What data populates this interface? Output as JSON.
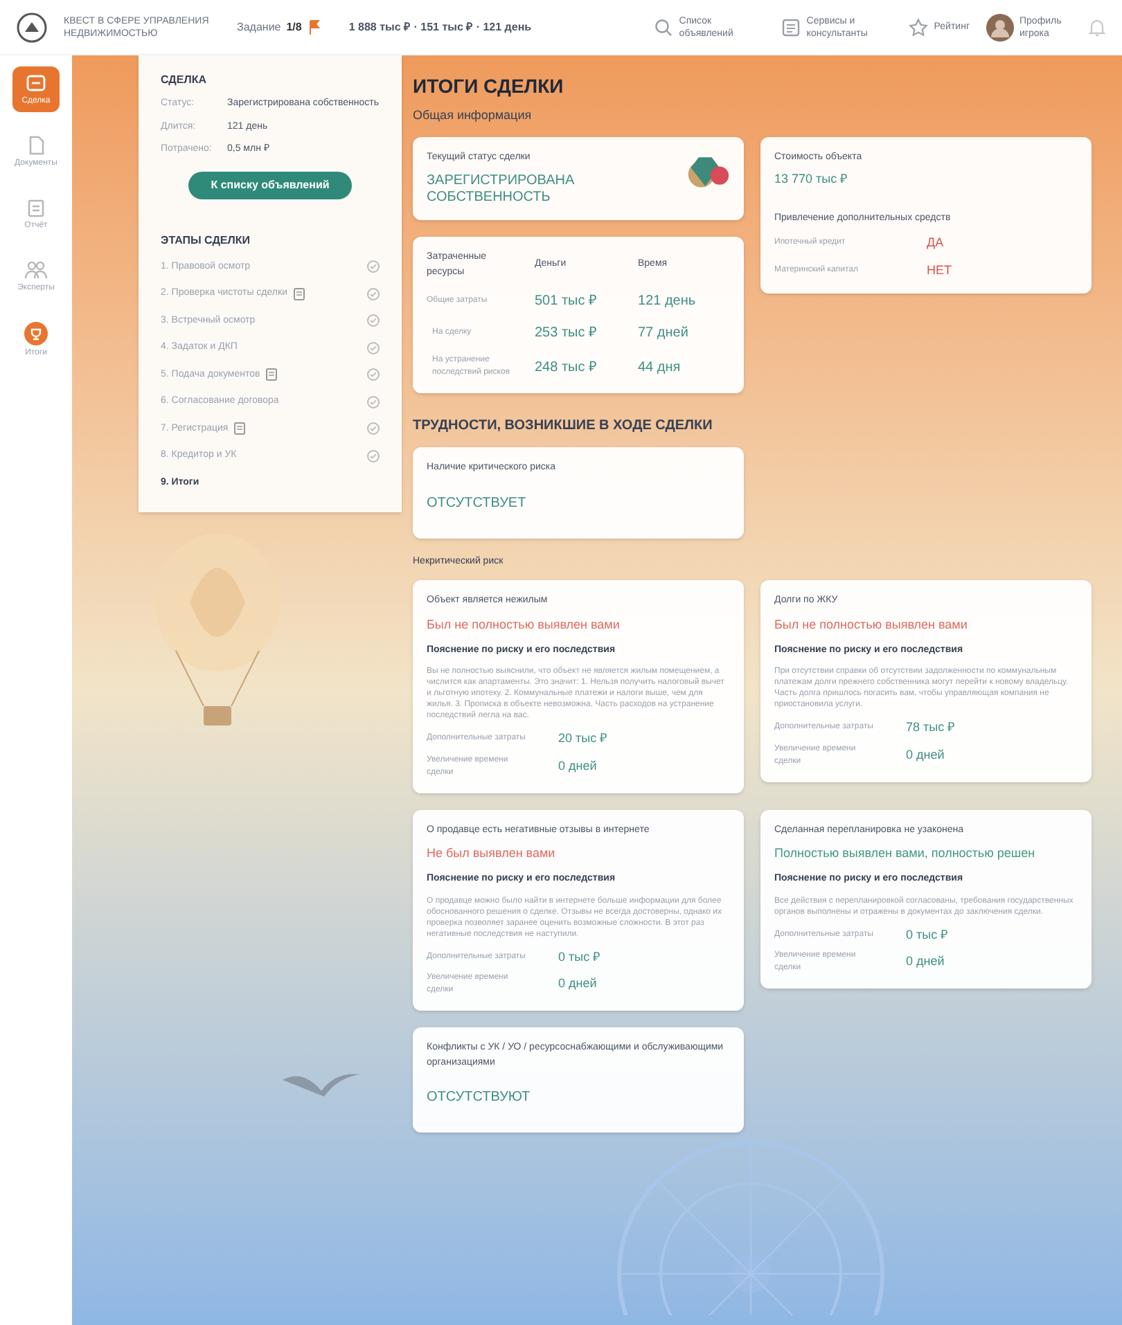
{
  "header": {
    "title": "КВЕСТ В СФЕРЕ УПРАВЛЕНИЯ НЕДВИЖИМОСТЬЮ",
    "task_label": "Задание",
    "task_value": "1/8",
    "stats": "1 888 тыс ₽ · 151 тыс ₽ · 121 день",
    "nav": [
      {
        "label": "Список объявлений",
        "kind": "search"
      },
      {
        "label": "Сервисы и консультанты",
        "kind": "list"
      },
      {
        "label": "Рейтинг",
        "kind": "star"
      }
    ],
    "profile": "Профиль игрока"
  },
  "rail": [
    {
      "label": "Сделка",
      "kind": "deal",
      "selected": true
    },
    {
      "label": "Документы",
      "kind": "doc",
      "selected": false
    },
    {
      "label": "Отчёт",
      "kind": "report",
      "selected": false
    },
    {
      "label": "Эксперты",
      "kind": "people",
      "selected": false
    },
    {
      "label": "Итоги",
      "kind": "result",
      "selected": false
    }
  ],
  "deal": {
    "title": "СДЕЛКА",
    "fields": [
      {
        "label": "Статус:",
        "value": "Зарегистрирована собственность"
      },
      {
        "label": "Длится:",
        "value": "121 день"
      },
      {
        "label": "Потрачено:",
        "value": "0,5 млн ₽"
      }
    ],
    "button": "К списку объявлений",
    "stages_title": "ЭТАПЫ СДЕЛКИ",
    "stages": [
      {
        "label": "1. Правовой осмотр",
        "document": false,
        "done": true,
        "selected": false
      },
      {
        "label": "2. Проверка чистоты сделки",
        "document": true,
        "done": true,
        "selected": false
      },
      {
        "label": "3. Встречный осмотр",
        "document": false,
        "done": true,
        "selected": false
      },
      {
        "label": "4. Задаток и ДКП",
        "document": false,
        "done": true,
        "selected": false
      },
      {
        "label": "5. Подача документов",
        "document": true,
        "done": true,
        "selected": false
      },
      {
        "label": "6. Согласование договора",
        "document": false,
        "done": true,
        "selected": false
      },
      {
        "label": "7. Регистрация",
        "document": true,
        "done": true,
        "selected": false
      },
      {
        "label": "8. Кредитор и УК",
        "document": false,
        "done": true,
        "selected": false
      },
      {
        "label": "9. Итоги",
        "document": false,
        "done": false,
        "selected": true
      }
    ]
  },
  "summary": {
    "title": "ИТОГИ СДЕЛКИ",
    "subtitle": "Общая информация",
    "status": {
      "label": "Текущий статус сделки",
      "value": "ЗАРЕГИСТРИРОВАНА СОБСТВЕННОСТЬ"
    },
    "price": {
      "label": "Стоимость объекта",
      "value": "13 770 тыс ₽",
      "funds_title": "Привлечение дополнительных средств",
      "funds": [
        {
          "label": "Ипотечный кредит",
          "value": "ДА"
        },
        {
          "label": "Материнский капитал",
          "value": "НЕТ"
        }
      ]
    },
    "resources": {
      "columns": [
        "Затраченные ресурсы",
        "Деньги",
        "Время"
      ],
      "rows": [
        {
          "label": "Общие затраты",
          "money": "501 тыс ₽",
          "time": "121 день"
        },
        {
          "label": "На сделку",
          "money": "253 тыс ₽",
          "time": "77 дней"
        },
        {
          "label": "На устранение последствий рисков",
          "money": "248 тыс ₽",
          "time": "44 дня"
        }
      ]
    }
  },
  "difficulties": {
    "title": "ТРУДНОСТИ, ВОЗНИКШИЕ В ХОДЕ СДЕЛКИ",
    "critical": {
      "label": "Наличие критического риска",
      "value": "ОТСУТСТВУЕТ"
    },
    "noncritical_label": "Некритический риск",
    "risks": [
      {
        "title": "Объект является нежилым",
        "outcome": "Был не полностью выявлен вами",
        "color": "#e06a5e",
        "explain_title": "Пояснение по риску и его последствия",
        "text": "Вы не полностью выяснили, что объект не является жилым помещением, а числится как апартаменты. Это значит: 1. Нельзя получить налоговый вычет и льготную ипотеку. 2. Коммунальные платежи и налоги выше, чем для жилья. 3. Прописка в объекте невозможна. Часть расходов на устранение последствий легла на вас.",
        "cost_label": "Дополнительные затраты",
        "cost": "20 тыс ₽",
        "time_label": "Увеличение времени сделки",
        "time": "0 дней"
      },
      {
        "title": "Долги по ЖКУ",
        "outcome": "Был не полностью выявлен вами",
        "color": "#e06a5e",
        "explain_title": "Пояснение по риску и его последствия",
        "text": "При отсутствии справки об отсутствии задолженности по коммунальным платежам долги прежнего собственника могут перейти к новому владельцу. Часть долга пришлось погасить вам, чтобы управляющая компания не приостановила услуги.",
        "cost_label": "Дополнительные затраты",
        "cost": "78 тыс ₽",
        "time_label": "Увеличение времени сделки",
        "time": "0 дней"
      },
      {
        "title": "О продавце есть негативные отзывы в интернете",
        "outcome": "Не был выявлен вами",
        "color": "#e06a5e",
        "explain_title": "Пояснение по риску и его последствия",
        "text": "О продавце можно было найти в интернете больше информации для более обоснованного решения о сделке. Отзывы не всегда достоверны, однако их проверка позволяет заранее оценить возможные сложности. В этот раз негативные последствия не наступили.",
        "cost_label": "Дополнительные затраты",
        "cost": "0 тыс ₽",
        "time_label": "Увеличение времени сделки",
        "time": "0 дней"
      },
      {
        "title": "Сделанная перепланировка не узаконена",
        "outcome": "Полностью выявлен вами, полностью решен",
        "color": "#3f9a7c",
        "explain_title": "Пояснение по риску и его последствия",
        "text": "Все действия с перепланировкой согласованы, требования государственных органов выполнены и отражены в документах до заключения сделки.",
        "cost_label": "Дополнительные затраты",
        "cost": "0 тыс ₽",
        "time_label": "Увеличение времени сделки",
        "time": "0 дней"
      }
    ],
    "conflicts": {
      "label": "Конфликты с УК / УО / ресурсоснабжающими и обслуживающими организациями",
      "value": "ОТСУТСТВУЮТ"
    }
  }
}
